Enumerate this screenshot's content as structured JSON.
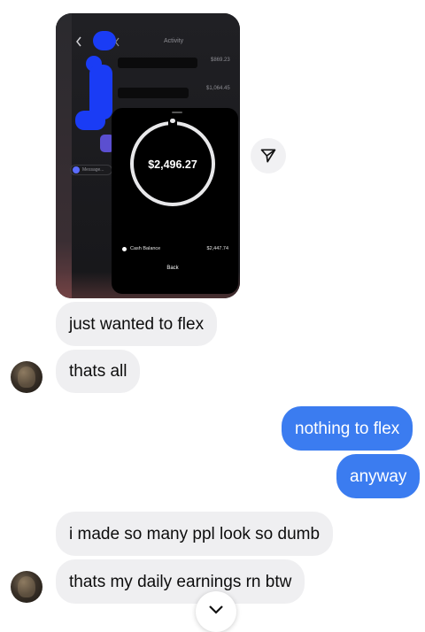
{
  "shared_screenshot": {
    "header_title": "Activity",
    "amounts": [
      "$869.23",
      "$1,064.45"
    ],
    "message_placeholder": "Message...",
    "balance": "$2,496.27",
    "cash_balance_label": "Cash Balance",
    "cash_balance_value": "$2,447.74",
    "back_label": "Back"
  },
  "icons": {
    "share": "paper-plane-icon",
    "scroll": "chevron-down-icon"
  },
  "messages": [
    {
      "from": "them",
      "text": "just wanted to flex"
    },
    {
      "from": "them",
      "text": "thats all"
    },
    {
      "from": "me",
      "text": "nothing to flex"
    },
    {
      "from": "me",
      "text": "anyway"
    },
    {
      "from": "them",
      "text": "i made so many ppl look so dumb"
    },
    {
      "from": "them",
      "text": "thats my daily earnings rn btw"
    }
  ],
  "colors": {
    "outgoing_bubble": "#3b7cf0",
    "incoming_bubble": "#efeff1"
  }
}
